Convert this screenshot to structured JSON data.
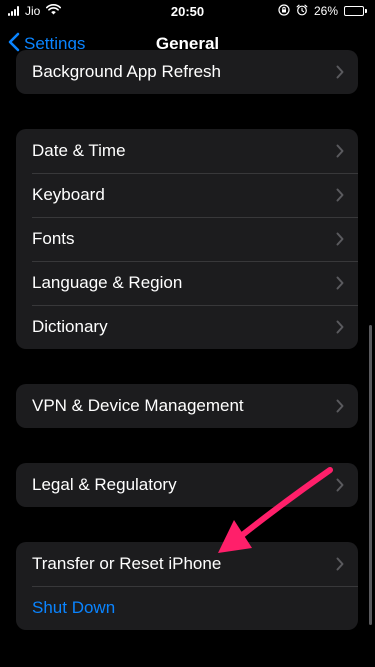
{
  "status_bar": {
    "carrier": "Jio",
    "time": "20:50",
    "battery_percent": "26%",
    "battery_level": 0.26,
    "icons": [
      "signal-icon",
      "wifi-icon",
      "orientation-lock-icon",
      "alarm-icon",
      "battery-icon"
    ]
  },
  "nav": {
    "back_label": "Settings",
    "title": "General"
  },
  "groups": {
    "top": {
      "rows": [
        {
          "label": "Background App Refresh"
        }
      ]
    },
    "datetime": {
      "rows": [
        {
          "label": "Date & Time"
        },
        {
          "label": "Keyboard"
        },
        {
          "label": "Fonts"
        },
        {
          "label": "Language & Region"
        },
        {
          "label": "Dictionary"
        }
      ]
    },
    "vpn": {
      "rows": [
        {
          "label": "VPN & Device Management"
        }
      ]
    },
    "legal": {
      "rows": [
        {
          "label": "Legal & Regulatory"
        }
      ]
    },
    "reset": {
      "rows": [
        {
          "label": "Transfer or Reset iPhone"
        },
        {
          "label": "Shut Down"
        }
      ]
    }
  },
  "colors": {
    "background": "#000000",
    "cell": "#1c1c1e",
    "accent": "#0a84ff",
    "annotation_arrow": "#ff1f6a"
  }
}
